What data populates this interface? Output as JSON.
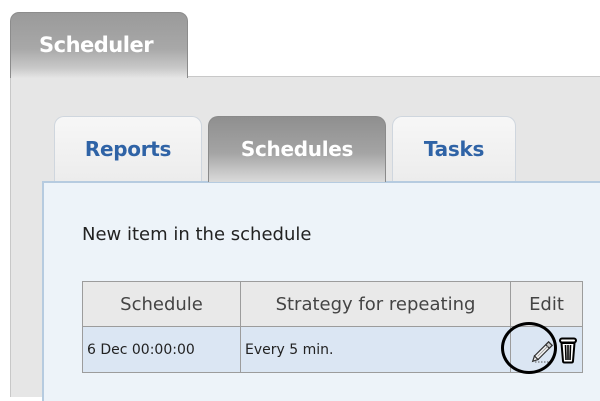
{
  "scheduler_tab": {
    "label": "Scheduler"
  },
  "tabs": [
    {
      "label": "Reports",
      "active": false
    },
    {
      "label": "Schedules",
      "active": true
    },
    {
      "label": "Tasks",
      "active": false
    }
  ],
  "section": {
    "title": "New item in the schedule"
  },
  "table": {
    "headers": [
      "Schedule",
      "Strategy for repeating",
      "Edit"
    ],
    "rows": [
      {
        "schedule": "6 Dec 00:00:00",
        "strategy": "Every 5 min."
      }
    ]
  },
  "icons": {
    "edit": "pencil-icon",
    "delete": "trash-icon"
  },
  "colors": {
    "tab_text": "#2f63a6",
    "active_tab_text": "#ffffff",
    "content_background": "#edf3f9",
    "content_border": "#b6cbe0",
    "row_background": "#dbe6f3"
  }
}
